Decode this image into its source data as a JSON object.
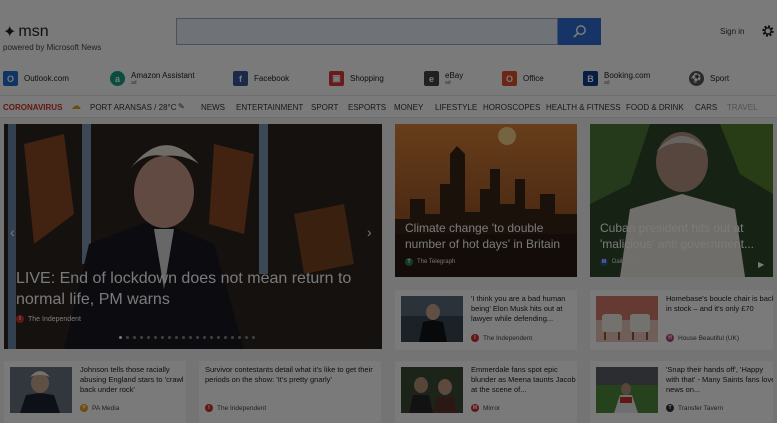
{
  "header": {
    "logo_text": "msn",
    "powered_by": "powered by Microsoft News",
    "search_placeholder": "",
    "sign_in": "Sign in"
  },
  "quick_links": [
    {
      "label": "Outlook.com",
      "sub": "",
      "icon": "outlook-icon",
      "color": "#1f6fd1"
    },
    {
      "label": "Amazon Assistant",
      "sub": "ad",
      "icon": "amazon-icon",
      "color": "#16a085"
    },
    {
      "label": "Facebook",
      "sub": "",
      "icon": "facebook-icon",
      "color": "#3b5998"
    },
    {
      "label": "Shopping",
      "sub": "",
      "icon": "shopping-bag-icon",
      "color": "#d93a3a"
    },
    {
      "label": "eBay",
      "sub": "ad",
      "icon": "ebay-icon",
      "color": "#444444"
    },
    {
      "label": "Office",
      "sub": "",
      "icon": "office-icon",
      "color": "#e0532b"
    },
    {
      "label": "Booking.com",
      "sub": "ad",
      "icon": "booking-icon",
      "color": "#123e8a"
    },
    {
      "label": "Sport",
      "sub": "",
      "icon": "sport-icon",
      "color": "#555555"
    }
  ],
  "nav": {
    "coronavirus": "CORONAVIRUS",
    "weather": "PORT ARANSAS / 28°C",
    "items": [
      "NEWS",
      "ENTERTAINMENT",
      "SPORT",
      "ESPORTS",
      "MONEY",
      "LIFESTYLE",
      "HOROSCOPES",
      "HEALTH & FITNESS",
      "FOOD & DRINK",
      "CARS",
      "TRAVEL"
    ]
  },
  "hero": {
    "title": "LIVE: End of lockdown does not mean return to normal life, PM warns",
    "source": "The Independent"
  },
  "tiles": [
    {
      "title": "Climate change 'to double number of hot days' in Britain",
      "source": "The Telegraph"
    },
    {
      "title": "Cuban president hits out at 'malicious' anti government...",
      "source": "Daily Mail"
    }
  ],
  "small_cards": [
    {
      "title": "'I think you are a bad human being' Elon Musk hits out at lawyer while defending...",
      "source": "The Independent",
      "badge_color": "#d0302a"
    },
    {
      "title": "Homebase's boucle chair is back in stock – and it's only £70",
      "source": "House Beautiful (UK)",
      "badge_color": "#c0407a"
    },
    {
      "title": "Johnson tells those racially abusing England stars to 'crawl back under rock'",
      "source": "PA Media",
      "badge_color": "#e6a21a"
    },
    {
      "title": "Survivor contestants detail what it's like to get their periods on the show: 'It's pretty gnarly'",
      "source": "The Independent",
      "badge_color": "#d0302a"
    },
    {
      "title": "Emmerdale fans spot epic blunder as Meena taunts Jacob at the scene of...",
      "source": "Mirror",
      "badge_color": "#d0302a"
    },
    {
      "title": "'Snap their hands off', 'Happy with that' - Many Saints fans love news on...",
      "source": "Transfer Tavern",
      "badge_color": "#333333"
    }
  ]
}
